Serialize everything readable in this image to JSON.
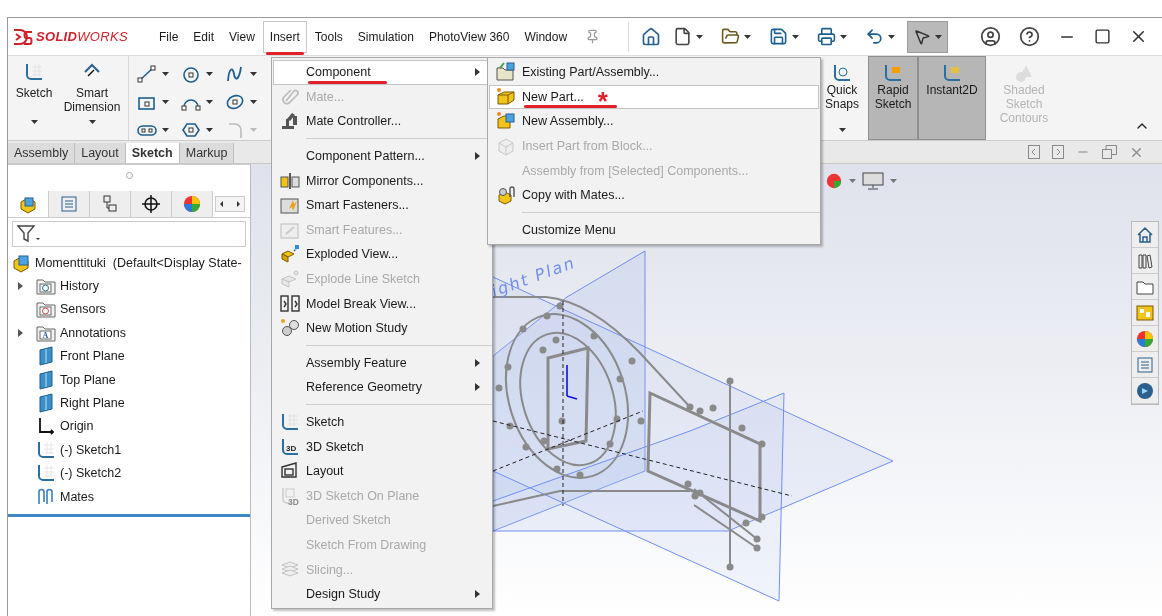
{
  "window": {
    "logo": "**SOLID**WORKS"
  },
  "menu_bar": [
    {
      "label": "File",
      "selected": false,
      "underlined": false
    },
    {
      "label": "Edit",
      "selected": false,
      "underlined": false
    },
    {
      "label": "View",
      "selected": false,
      "underlined": false
    },
    {
      "label": "Insert",
      "selected": true,
      "underlined": true
    },
    {
      "label": "Tools",
      "selected": false,
      "underlined": false
    },
    {
      "label": "Simulation",
      "selected": false,
      "underlined": false
    },
    {
      "label": "PhotoView 360",
      "selected": false,
      "underlined": false
    },
    {
      "label": "Window",
      "selected": false,
      "underlined": false
    }
  ],
  "quick_access": {
    "select_on": true
  },
  "command_manager": {
    "tools": [
      {
        "label": "Sketch"
      },
      {
        "label": "Smart Dimension"
      }
    ],
    "toggles": [
      {
        "label": "Quick Snaps",
        "on": false,
        "disabled": false
      },
      {
        "label": "Rapid Sketch",
        "on": true,
        "disabled": false
      },
      {
        "label": "Instant2D",
        "on": true,
        "disabled": false
      },
      {
        "label": "Shaded Sketch Contours",
        "on": false,
        "disabled": true
      }
    ]
  },
  "command_tabs": [
    {
      "label": "Assembly",
      "selected": false
    },
    {
      "label": "Layout",
      "selected": false
    },
    {
      "label": "Sketch",
      "selected": true
    },
    {
      "label": "Markup",
      "selected": false
    }
  ],
  "panel_tabs": [
    {
      "selected": true
    },
    {
      "selected": false
    },
    {
      "selected": false
    },
    {
      "selected": false
    },
    {
      "selected": false
    }
  ],
  "feature_tree": {
    "label": "Momenttituki  (Default<Display State-",
    "children": [
      {
        "label": "History",
        "collapsed": true
      },
      {
        "label": "Sensors",
        "collapsed": false
      },
      {
        "label": "Annotations",
        "collapsed": true,
        "badge": "A"
      },
      {
        "label": "Front Plane",
        "collapsed": false
      },
      {
        "label": "Top Plane",
        "collapsed": false
      },
      {
        "label": "Right Plane",
        "collapsed": false
      },
      {
        "label": "Origin",
        "collapsed": false
      },
      {
        "label": "(-) Sketch1",
        "collapsed": false
      },
      {
        "label": "(-) Sketch2",
        "collapsed": false
      },
      {
        "label": "Mates",
        "collapsed": false
      }
    ]
  },
  "graphics": {
    "plane_label": "ight Plan"
  },
  "insert_menu": {
    "items": [
      {
        "kind": "item",
        "label": "Component",
        "disabled": false,
        "selected": true,
        "submenu": true,
        "underlined": true
      },
      {
        "kind": "item",
        "label": "Mate...",
        "disabled": true,
        "selected": false,
        "submenu": false,
        "underlined": false
      },
      {
        "kind": "item",
        "label": "Mate Controller...",
        "disabled": false,
        "selected": false,
        "submenu": false,
        "underlined": false
      },
      {
        "kind": "separator"
      },
      {
        "kind": "item",
        "label": "Component Pattern...",
        "disabled": false,
        "selected": false,
        "submenu": true,
        "underlined": false
      },
      {
        "kind": "item",
        "label": "Mirror Components...",
        "disabled": false,
        "selected": false,
        "submenu": false,
        "underlined": false
      },
      {
        "kind": "item",
        "label": "Smart Fasteners...",
        "disabled": false,
        "selected": false,
        "submenu": false,
        "underlined": false
      },
      {
        "kind": "item",
        "label": "Smart Features...",
        "disabled": true,
        "selected": false,
        "submenu": false,
        "underlined": false
      },
      {
        "kind": "item",
        "label": "Exploded View...",
        "disabled": false,
        "selected": false,
        "submenu": false,
        "underlined": false
      },
      {
        "kind": "item",
        "label": "Explode Line Sketch",
        "disabled": true,
        "selected": false,
        "submenu": false,
        "underlined": false
      },
      {
        "kind": "item",
        "label": "Model Break View...",
        "disabled": false,
        "selected": false,
        "submenu": false,
        "underlined": false
      },
      {
        "kind": "item",
        "label": "New Motion Study",
        "disabled": false,
        "selected": false,
        "submenu": false,
        "underlined": false
      },
      {
        "kind": "separator"
      },
      {
        "kind": "item",
        "label": "Assembly Feature",
        "disabled": false,
        "selected": false,
        "submenu": true,
        "underlined": false
      },
      {
        "kind": "item",
        "label": "Reference Geometry",
        "disabled": false,
        "selected": false,
        "submenu": true,
        "underlined": false
      },
      {
        "kind": "separator"
      },
      {
        "kind": "item",
        "label": "Sketch",
        "disabled": false,
        "selected": false,
        "submenu": false,
        "underlined": false
      },
      {
        "kind": "item",
        "label": "3D Sketch",
        "disabled": false,
        "selected": false,
        "submenu": false,
        "underlined": false,
        "badge": "3D"
      },
      {
        "kind": "item",
        "label": "Layout",
        "disabled": false,
        "selected": false,
        "submenu": false,
        "underlined": false
      },
      {
        "kind": "item",
        "label": "3D Sketch On Plane",
        "disabled": true,
        "selected": false,
        "submenu": false,
        "underlined": false,
        "badge": "3D"
      },
      {
        "kind": "item",
        "label": "Derived Sketch",
        "disabled": true,
        "selected": false,
        "submenu": false,
        "underlined": false
      },
      {
        "kind": "item",
        "label": "Sketch From Drawing",
        "disabled": true,
        "selected": false,
        "submenu": false,
        "underlined": false
      },
      {
        "kind": "item",
        "label": "Slicing...",
        "disabled": true,
        "selected": false,
        "submenu": false,
        "underlined": false
      },
      {
        "kind": "item",
        "label": "Design Study",
        "disabled": false,
        "selected": false,
        "submenu": true,
        "underlined": false
      }
    ]
  },
  "component_submenu": {
    "items": [
      {
        "kind": "item",
        "label": "Existing Part/Assembly...",
        "disabled": false,
        "selected": false,
        "underlined": false
      },
      {
        "kind": "item",
        "label": "New Part...",
        "disabled": false,
        "selected": true,
        "underlined": true,
        "marker": "*"
      },
      {
        "kind": "item",
        "label": "New Assembly...",
        "disabled": false,
        "selected": false,
        "underlined": false
      },
      {
        "kind": "item",
        "label": "Insert Part from Block...",
        "disabled": true,
        "selected": false,
        "underlined": false
      },
      {
        "kind": "item",
        "label": "Assembly from [Selected] Components...",
        "disabled": true,
        "selected": false,
        "underlined": false
      },
      {
        "kind": "item",
        "label": "Copy with Mates...",
        "disabled": false,
        "selected": false,
        "underlined": false
      },
      {
        "kind": "separator"
      },
      {
        "kind": "item",
        "label": "Customize Menu",
        "disabled": false,
        "selected": false,
        "underlined": false
      }
    ]
  }
}
